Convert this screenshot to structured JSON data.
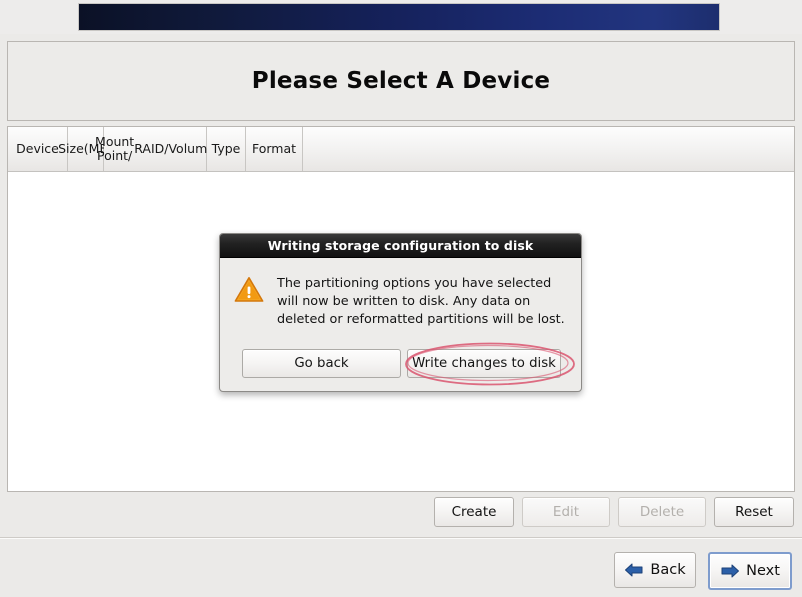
{
  "banner": {
    "name": "top-gradient-banner",
    "gradient_from": "#0b1126",
    "gradient_to": "#22357f"
  },
  "header": {
    "title": "Please Select A Device"
  },
  "table": {
    "columns": [
      {
        "label": "Device"
      },
      {
        "label": "Size\n(MB)"
      },
      {
        "label": "Mount Point/\nRAID/Volume"
      },
      {
        "label": "Type"
      },
      {
        "label": "Format"
      }
    ],
    "rows": []
  },
  "actions": {
    "create_label": "Create",
    "edit_label": "Edit",
    "delete_label": "Delete",
    "reset_label": "Reset",
    "edit_enabled": false,
    "delete_enabled": false
  },
  "navigation": {
    "back_label": "Back",
    "next_label": "Next",
    "arrow_color": "#2b5fa8"
  },
  "dialog": {
    "title": "Writing storage configuration to disk",
    "message": "The partitioning options you have selected\nwill now be written to disk.  Any data on\ndeleted or reformatted partitions will be lost.",
    "icon": "warning-triangle-icon",
    "icon_color": "#f0921e",
    "go_back_label": "Go back",
    "write_changes_label": "Write changes to disk"
  },
  "annotation": {
    "shape": "ellipse",
    "color": "#d9556f",
    "target": "write-changes-to-disk-button"
  }
}
